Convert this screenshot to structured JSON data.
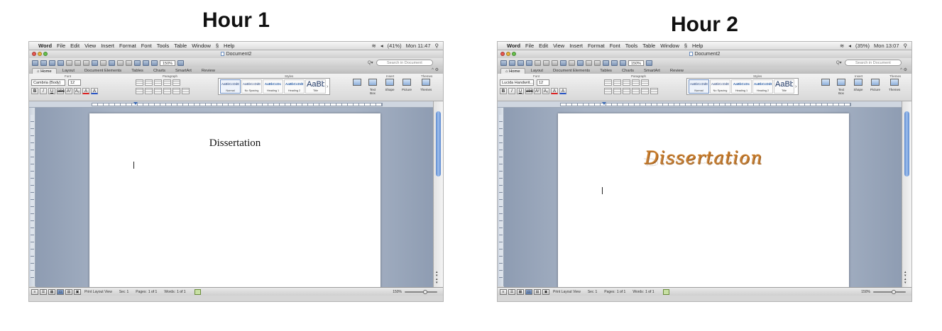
{
  "slides": [
    {
      "hour_title": "Hour 1",
      "menubar": {
        "app": "Word",
        "items": [
          "File",
          "Edit",
          "View",
          "Insert",
          "Format",
          "Font",
          "Tools",
          "Table",
          "Window",
          "Help"
        ],
        "time": "Mon 11:47",
        "battery": "(41%)"
      },
      "window_title": "Document2",
      "zoom": "150%",
      "search_placeholder": "Search in Document",
      "ribbon_tabs": [
        "Home",
        "Layout",
        "Document Elements",
        "Tables",
        "Charts",
        "SmartArt",
        "Review"
      ],
      "group_labels": {
        "font": "Font",
        "paragraph": "Paragraph",
        "styles": "Styles",
        "insert": "Insert",
        "themes": "Themes"
      },
      "font_name": "Cambria (Body)",
      "font_size": "12",
      "styles": [
        {
          "sample": "AaBbCcDdEe",
          "name": "Normal"
        },
        {
          "sample": "AaBbCcDdEe",
          "name": "No Spacing"
        },
        {
          "sample": "AaBbCcDc",
          "name": "Heading 1"
        },
        {
          "sample": "AaBbCcDdEe",
          "name": "Heading 2"
        },
        {
          "sample": "AaBbC",
          "name": "Title"
        }
      ],
      "insert_buttons": [
        "Text Box",
        "Shape",
        "Picture",
        "Themes"
      ],
      "document_text": "Dissertation",
      "status": {
        "view": "Print Layout View",
        "sec": "Sec",
        "sec_val": "1",
        "pages": "Pages:",
        "pages_val": "1 of 1",
        "words": "Words:",
        "words_val": "1 of 1",
        "zoom": "150%"
      }
    },
    {
      "hour_title": "Hour 2",
      "menubar": {
        "app": "Word",
        "items": [
          "File",
          "Edit",
          "View",
          "Insert",
          "Format",
          "Font",
          "Tools",
          "Table",
          "Window",
          "Help"
        ],
        "time": "Mon 13:07",
        "battery": "(35%)"
      },
      "window_title": "Document2",
      "zoom": "150%",
      "search_placeholder": "Search in Document",
      "ribbon_tabs": [
        "Home",
        "Layout",
        "Document Elements",
        "Tables",
        "Charts",
        "SmartArt",
        "Review"
      ],
      "group_labels": {
        "font": "Font",
        "paragraph": "Paragraph",
        "styles": "Styles",
        "insert": "Insert",
        "themes": "Themes"
      },
      "font_name": "Lucida Handwrit...",
      "font_size": "12",
      "styles": [
        {
          "sample": "AaBbCcDdEe",
          "name": "Normal"
        },
        {
          "sample": "AaBbCcDdEe",
          "name": "No Spacing"
        },
        {
          "sample": "AaBbCcDc",
          "name": "Heading 1"
        },
        {
          "sample": "AaBbCcDdEe",
          "name": "Heading 2"
        },
        {
          "sample": "AaBbC",
          "name": "Title"
        }
      ],
      "insert_buttons": [
        "Text Box",
        "Shape",
        "Picture",
        "Themes"
      ],
      "document_text": "Dissertation",
      "status": {
        "view": "Print Layout View",
        "sec": "Sec",
        "sec_val": "1",
        "pages": "Pages:",
        "pages_val": "1 of 1",
        "words": "Words:",
        "words_val": "1 of 1",
        "zoom": "150%"
      }
    }
  ]
}
